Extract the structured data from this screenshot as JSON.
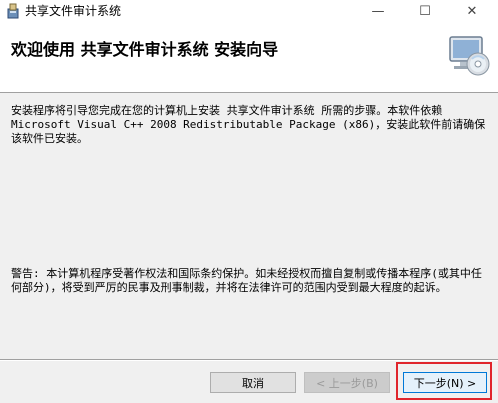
{
  "window": {
    "title": "共享文件审计系统",
    "minimize_glyph": "—",
    "maximize_glyph": "☐",
    "close_glyph": "✕"
  },
  "header": {
    "title": "欢迎使用 共享文件审计系统 安装向导"
  },
  "body": {
    "intro": "安装程序将引导您完成在您的计算机上安装 共享文件审计系统 所需的步骤。本软件依赖Microsoft Visual C++ 2008 Redistributable Package (x86)，安装此软件前请确保该软件已安装。",
    "warning": "警告: 本计算机程序受著作权法和国际条约保护。如未经授权而擅自复制或传播本程序(或其中任何部分)，将受到严厉的民事及刑事制裁，并将在法律许可的范围内受到最大程度的起诉。"
  },
  "buttons": {
    "cancel": "取消",
    "back": "< 上一步(B)",
    "next": "下一步(N) >"
  },
  "colors": {
    "highlight": "#e0252c",
    "accent": "#0078d7"
  },
  "icons": {
    "app": "installer-app-icon",
    "header_art": "computer-cd-icon"
  }
}
